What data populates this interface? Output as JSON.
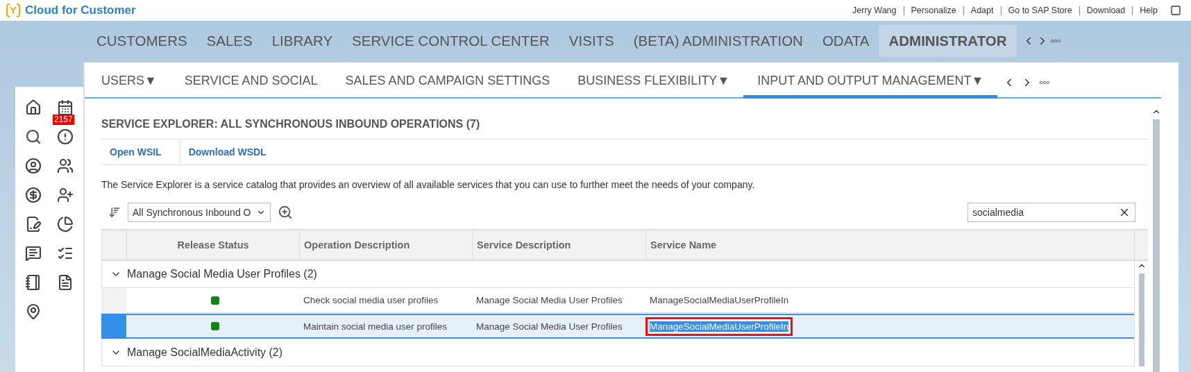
{
  "app": {
    "title": "Cloud for Customer"
  },
  "header_links": [
    "Jerry Wang",
    "Personalize",
    "Adapt",
    "Go to SAP Store",
    "Download",
    "Help"
  ],
  "main_tabs": [
    {
      "label": "CUSTOMERS",
      "selected": false
    },
    {
      "label": "SALES",
      "selected": false
    },
    {
      "label": "LIBRARY",
      "selected": false
    },
    {
      "label": "SERVICE CONTROL CENTER",
      "selected": false
    },
    {
      "label": "VISITS",
      "selected": false
    },
    {
      "label": "(BETA) ADMINISTRATION",
      "selected": false
    },
    {
      "label": "ODATA",
      "selected": false
    },
    {
      "label": "ADMINISTRATOR",
      "selected": true
    }
  ],
  "sub_tabs": [
    {
      "label": "USERS▼",
      "selected": false
    },
    {
      "label": "SERVICE AND SOCIAL",
      "selected": false
    },
    {
      "label": "SALES AND CAMPAIGN SETTINGS",
      "selected": false
    },
    {
      "label": "BUSINESS FLEXIBILITY▼",
      "selected": false
    },
    {
      "label": "INPUT AND OUTPUT MANAGEMENT▼",
      "selected": true
    }
  ],
  "sidebar": {
    "badge": "2157"
  },
  "page": {
    "title": "SERVICE EXPLORER: ALL SYNCHRONOUS INBOUND OPERATIONS (7)",
    "links": [
      "Open WSIL",
      "Download WSDL"
    ],
    "description": "The Service Explorer is a service catalog that provides an overview of all available services that you can use to further meet the needs of your company.",
    "filter": {
      "value": "All Synchronous Inbound O"
    },
    "search": {
      "value": "socialmedia"
    }
  },
  "table": {
    "columns": [
      "Release Status",
      "Operation Description",
      "Service Description",
      "Service Name"
    ],
    "groups": [
      {
        "title": "Manage Social Media User Profiles (2)",
        "expanded": true,
        "rows": [
          {
            "color": "#128512",
            "operation": "Check social media user profiles",
            "service_description": "Manage Social Media User Profiles",
            "service_name": "ManageSocialMediaUserProfileIn",
            "selected": false,
            "highlighted": false
          },
          {
            "color": "#128512",
            "operation": "Maintain social media user profiles",
            "service_description": "Manage Social Media User Profiles",
            "service_name": "ManageSocialMediaUserProfileIn",
            "selected": true,
            "highlighted": true
          }
        ]
      },
      {
        "title": "Manage SocialMediaActivity (2)",
        "expanded": true
      }
    ]
  }
}
